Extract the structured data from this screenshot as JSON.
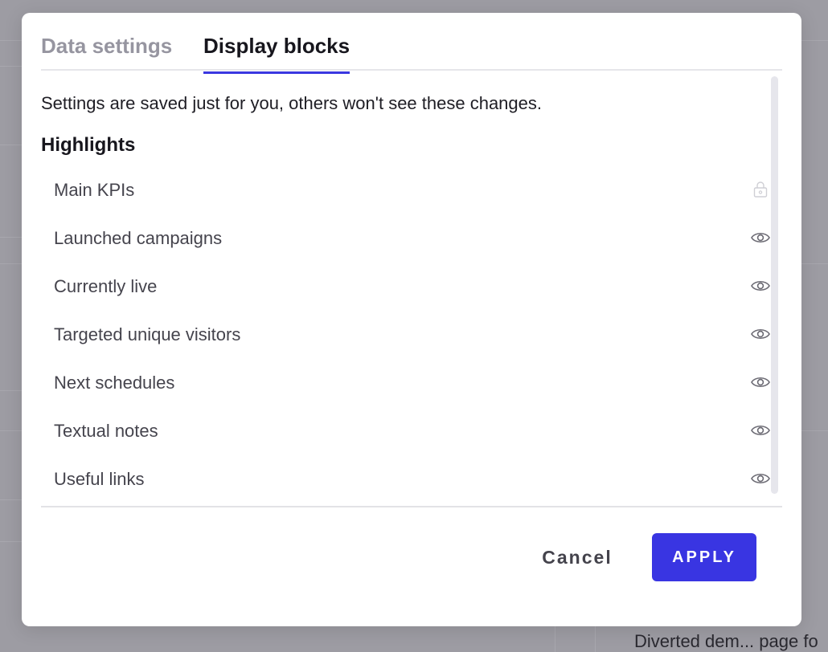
{
  "modal": {
    "tabs": [
      {
        "label": "Data settings",
        "active": false
      },
      {
        "label": "Display blocks",
        "active": true
      }
    ],
    "notice": "Settings are saved just for you, others won't see these changes.",
    "section_title": "Highlights",
    "items": [
      {
        "label": "Main KPIs",
        "icon": "lock-icon"
      },
      {
        "label": "Launched campaigns",
        "icon": "eye-icon"
      },
      {
        "label": "Currently live",
        "icon": "eye-icon"
      },
      {
        "label": "Targeted unique visitors",
        "icon": "eye-icon"
      },
      {
        "label": "Next schedules",
        "icon": "eye-icon"
      },
      {
        "label": "Textual notes",
        "icon": "eye-icon"
      },
      {
        "label": "Useful links",
        "icon": "eye-icon"
      }
    ],
    "cancel_label": "Cancel",
    "apply_label": "APPLY"
  },
  "background": {
    "partial_text": "Diverted dem... page fo"
  },
  "colors": {
    "accent": "#3935e2",
    "overlay": "#9d9ca3"
  }
}
